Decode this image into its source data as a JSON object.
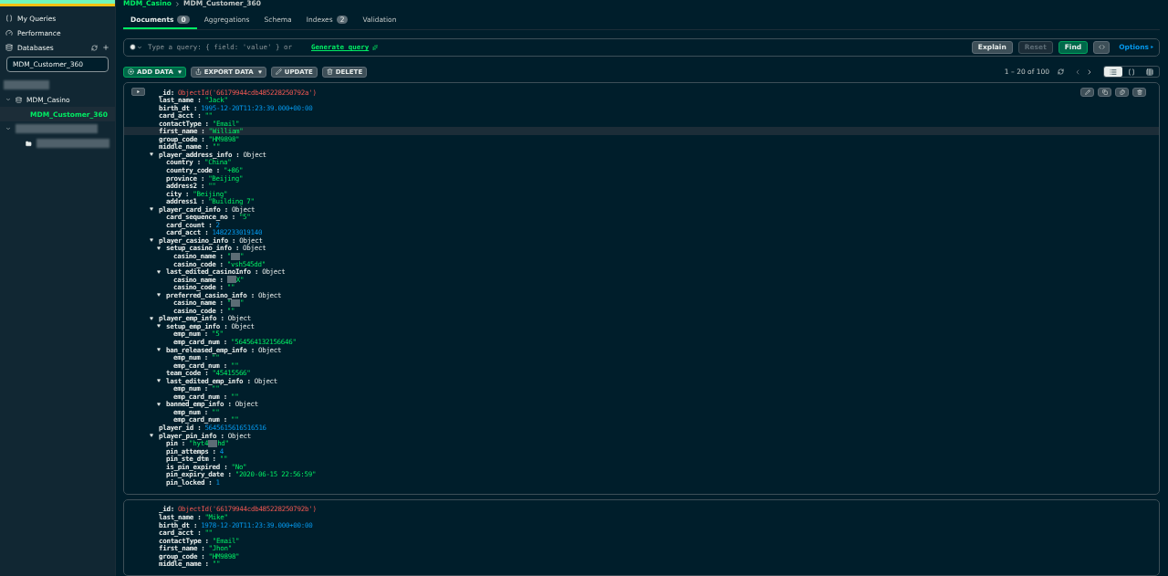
{
  "sidebar": {
    "nav": [
      {
        "label": "My Queries"
      },
      {
        "label": "Performance"
      }
    ],
    "databases_label": "Databases",
    "filter_value": "MDM_Customer_360",
    "tree": [
      {
        "kind": "redacted"
      },
      {
        "kind": "database",
        "label": "MDM_Casino",
        "expanded": true,
        "children": [
          {
            "label": "MDM_Customer_360",
            "selected": true
          }
        ]
      },
      {
        "kind": "redacted_database",
        "expanded": true
      }
    ]
  },
  "breadcrumb": {
    "database": "MDM_Casino",
    "collection": "MDM_Customer_360"
  },
  "tabs": [
    {
      "label": "Documents",
      "count": "0",
      "selected": true
    },
    {
      "label": "Aggregations",
      "selected": false
    },
    {
      "label": "Schema",
      "selected": false
    },
    {
      "label": "Indexes",
      "count": "2",
      "selected": false
    },
    {
      "label": "Validation",
      "selected": false
    }
  ],
  "query": {
    "placeholder": "Type a query: { field: 'value' } or",
    "generate_link": "Generate query",
    "buttons": [
      {
        "label": "Explain",
        "kind": "default"
      },
      {
        "label": "Reset",
        "kind": "disabled"
      },
      {
        "label": "Find",
        "kind": "primary"
      }
    ],
    "options": "Options"
  },
  "toolbar": {
    "buttons": [
      {
        "label": "ADD DATA",
        "kind": "primary",
        "caret": true
      },
      {
        "label": "EXPORT DATA",
        "kind": "default",
        "caret": true
      },
      {
        "label": "UPDATE",
        "kind": "default",
        "caret": false
      },
      {
        "label": "DELETE",
        "kind": "default",
        "caret": false
      }
    ],
    "pagination": "1 – 20 of 100",
    "views": [
      {
        "selected": true
      },
      {
        "selected": false
      },
      {
        "selected": false
      }
    ]
  },
  "documents": [
    {
      "actions": true,
      "fields": [
        {
          "key": "_id:",
          "kind": "objectid",
          "value": "ObjectId('66179944cdb485228250792a')"
        },
        {
          "key": "last_name :",
          "kind": "string",
          "value": "\"Jack\""
        },
        {
          "key": "birth_dt :",
          "kind": "date",
          "value": "1995-12-20T11:23:39.000+00:00"
        },
        {
          "key": "card_acct :",
          "kind": "string",
          "value": "\"\""
        },
        {
          "key": "contactType :",
          "kind": "string",
          "value": "\"Email\""
        },
        {
          "key": "first_name :",
          "kind": "string",
          "value": "\"William\"",
          "highlighted": true
        },
        {
          "key": "group_code :",
          "kind": "string",
          "value": "\"HM9898\""
        },
        {
          "key": "middle_name :",
          "kind": "string",
          "value": "\"\""
        },
        {
          "key": "player_address_info :",
          "kind": "object",
          "value": "Object",
          "expanded": true,
          "children": [
            {
              "key": "country :",
              "kind": "string",
              "value": "\"China\""
            },
            {
              "key": "country_code :",
              "kind": "string",
              "value": "\"+86\""
            },
            {
              "key": "province :",
              "kind": "string",
              "value": "\"Beijing\""
            },
            {
              "key": "address2 :",
              "kind": "string",
              "value": "\"\""
            },
            {
              "key": "city :",
              "kind": "string",
              "value": "\"Beijing\""
            },
            {
              "key": "address1 :",
              "kind": "string",
              "value": "\"Building 7\""
            }
          ]
        },
        {
          "key": "player_card_info :",
          "kind": "object",
          "value": "Object",
          "expanded": true,
          "children": [
            {
              "key": "card_sequence_no :",
              "kind": "string",
              "value": "\"5\""
            },
            {
              "key": "card_count :",
              "kind": "number",
              "value": "2"
            },
            {
              "key": "card_acct :",
              "kind": "number",
              "value": "1482233019140"
            }
          ]
        },
        {
          "key": "player_casino_info :",
          "kind": "object",
          "value": "Object",
          "expanded": true,
          "children": [
            {
              "key": "setup_casino_info :",
              "kind": "object",
              "value": "Object",
              "expanded": true,
              "children": [
                {
                  "key": "casino_name :",
                  "kind": "redacted",
                  "value": "\"",
                  "value_after": "\""
                },
                {
                  "key": "casino_code :",
                  "kind": "string",
                  "value": "\"vsh545dd\""
                }
              ]
            },
            {
              "key": "last_edited_casinoInfo :",
              "kind": "object",
              "value": "Object",
              "expanded": true,
              "children": [
                {
                  "key": "casino_name :",
                  "kind": "redacted",
                  "value_after": "X\""
                },
                {
                  "key": "casino_code :",
                  "kind": "string",
                  "value": "\"\""
                }
              ]
            },
            {
              "key": "preferred_casino_info :",
              "kind": "object",
              "value": "Object",
              "expanded": true,
              "children": [
                {
                  "key": "casino_name :",
                  "kind": "redacted",
                  "value": "\"",
                  "value_after": "\""
                },
                {
                  "key": "casino_code :",
                  "kind": "string",
                  "value": "\"\""
                }
              ]
            }
          ]
        },
        {
          "key": "player_emp_info :",
          "kind": "object",
          "value": "Object",
          "expanded": true,
          "children": [
            {
              "key": "setup_emp_info :",
              "kind": "object",
              "value": "Object",
              "expanded": true,
              "children": [
                {
                  "key": "emp_num :",
                  "kind": "string",
                  "value": "\"5\""
                },
                {
                  "key": "emp_card_num :",
                  "kind": "string",
                  "value": "\"564564132156646\""
                }
              ]
            },
            {
              "key": "ban_released_emp_info :",
              "kind": "object",
              "value": "Object",
              "expanded": true,
              "children": [
                {
                  "key": "emp_num :",
                  "kind": "string",
                  "value": "\"\""
                },
                {
                  "key": "emp_card_num :",
                  "kind": "string",
                  "value": "\"\""
                }
              ]
            },
            {
              "key": "team_code :",
              "kind": "string",
              "value": "\"45415566\""
            },
            {
              "key": "last_edited_emp_info :",
              "kind": "object",
              "value": "Object",
              "expanded": true,
              "children": [
                {
                  "key": "emp_num :",
                  "kind": "string",
                  "value": "\"\""
                },
                {
                  "key": "emp_card_num :",
                  "kind": "string",
                  "value": "\"\""
                }
              ]
            },
            {
              "key": "banned_emp_info :",
              "kind": "object",
              "value": "Object",
              "expanded": true,
              "children": [
                {
                  "key": "emp_num :",
                  "kind": "string",
                  "value": "\"\""
                },
                {
                  "key": "emp_card_num :",
                  "kind": "string",
                  "value": "\"\""
                }
              ]
            }
          ]
        },
        {
          "key": "player_id :",
          "kind": "number",
          "value": "5645615616516516"
        },
        {
          "key": "player_pin_info :",
          "kind": "object",
          "value": "Object",
          "expanded": true,
          "children": [
            {
              "key": "pin :",
              "kind": "redacted",
              "value": "\"hyt4",
              "value_after": "hd\""
            },
            {
              "key": "pin_attemps :",
              "kind": "number",
              "value": "4"
            },
            {
              "key": "pin_ste_dtm :",
              "kind": "string",
              "value": "\"\""
            },
            {
              "key": "is_pin_expired :",
              "kind": "string",
              "value": "\"No\""
            },
            {
              "key": "pin_expiry_date :",
              "kind": "string",
              "value": "\"2020-06-15 22:56:59\""
            },
            {
              "key": "pin_locked :",
              "kind": "number",
              "value": "1"
            }
          ]
        }
      ]
    },
    {
      "actions": false,
      "fields": [
        {
          "key": "_id:",
          "kind": "objectid",
          "value": "ObjectId('66179944cdb485228250792b')"
        },
        {
          "key": "last_name :",
          "kind": "string",
          "value": "\"Mike\""
        },
        {
          "key": "birth_dt :",
          "kind": "date",
          "value": "1978-12-20T11:23:39.000+00:00"
        },
        {
          "key": "card_acct :",
          "kind": "string",
          "value": "\"\""
        },
        {
          "key": "contactType :",
          "kind": "string",
          "value": "\"Email\""
        },
        {
          "key": "first_name :",
          "kind": "string",
          "value": "\"Jhon\""
        },
        {
          "key": "group_code :",
          "kind": "string",
          "value": "\"HM9898\""
        },
        {
          "key": "middle_name :",
          "kind": "string",
          "value": "\"\""
        }
      ]
    }
  ]
}
